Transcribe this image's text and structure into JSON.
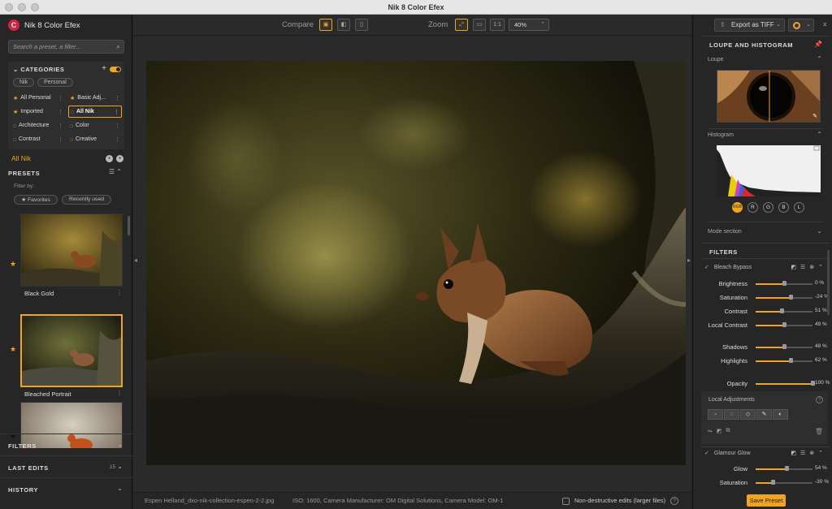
{
  "window": {
    "title": "Nik 8 Color Efex"
  },
  "app": {
    "brand": "Nik 8 Color Efex"
  },
  "search": {
    "placeholder": "Search a preset, a filter..."
  },
  "categories": {
    "heading": "CATEGORIES",
    "chips": [
      "Nik",
      "Personal"
    ],
    "items": [
      {
        "label": "All Personal",
        "marker": "star"
      },
      {
        "label": "Basic Adj...",
        "marker": "star"
      },
      {
        "label": "Imported",
        "marker": "star"
      },
      {
        "label": "All Nik",
        "marker": "dot",
        "selected": true
      },
      {
        "label": "Architecture",
        "marker": "dot"
      },
      {
        "label": "Color",
        "marker": "dot"
      },
      {
        "label": "Contrast",
        "marker": "dot"
      },
      {
        "label": "Creative",
        "marker": "dot"
      }
    ]
  },
  "current_category": "All Nik",
  "presets": {
    "heading": "PRESETS",
    "filter_by": "Filter by:",
    "filter_chips": [
      "★ Favorites",
      "Recently used"
    ],
    "items": [
      {
        "label": "Black Gold",
        "favorite": true
      },
      {
        "label": "Bleached Portrait",
        "favorite": true,
        "selected": true
      },
      {
        "label": "",
        "favorite": false
      }
    ]
  },
  "left_sections": [
    {
      "label": "FILTERS"
    },
    {
      "label": "LAST EDITS",
      "count": "15"
    },
    {
      "label": "HISTORY"
    }
  ],
  "toolbar": {
    "compare_label": "Compare",
    "zoom_label": "Zoom",
    "zoom_1to1": "1:1",
    "zoom_value": "40%"
  },
  "status": {
    "filename": "Espen Helland_dxo-nik-collection-espen-2-2.jpg",
    "meta": "ISO: 1600, Camera Manufacturer: OM Digital Solutions, Camera Model: OM-1",
    "nondestructive": "Non-destructive edits (larger files)",
    "help": "?"
  },
  "right": {
    "export_label": "Export as TIFF",
    "loupe_histogram": "LOUPE AND HISTOGRAM",
    "loupe": "Loupe",
    "histogram": "Histogram",
    "channels": [
      "RGB",
      "R",
      "G",
      "B",
      "L"
    ],
    "mode_section": "Mode section",
    "filters_heading": "FILTERS",
    "filter1": {
      "name": "Bleach Bypass",
      "sliders": [
        {
          "label": "Brightness",
          "value": "0 %",
          "pct": 0.5
        },
        {
          "label": "Saturation",
          "value": "-24 %",
          "pct": 0.62
        },
        {
          "label": "Contrast",
          "value": "51 %",
          "pct": 0.45
        },
        {
          "label": "Local Contrast",
          "value": "49 %",
          "pct": 0.5
        },
        {
          "label": "Shadows",
          "value": "48 %",
          "pct": 0.5
        },
        {
          "label": "Highlights",
          "value": "62 %",
          "pct": 0.62
        },
        {
          "label": "Opacity",
          "value": "100 %",
          "pct": 1.0
        }
      ]
    },
    "local_adjustments": "Local Adjustments",
    "filter2": {
      "name": "Glamour Glow",
      "sliders": [
        {
          "label": "Glow",
          "value": "54 %",
          "pct": 0.54
        },
        {
          "label": "Saturation",
          "value": "-30 %",
          "pct": 0.3
        }
      ]
    },
    "save_preset": "Save Preset"
  },
  "colors": {
    "accent": "#f1a51c",
    "brand": "#d6203c"
  }
}
